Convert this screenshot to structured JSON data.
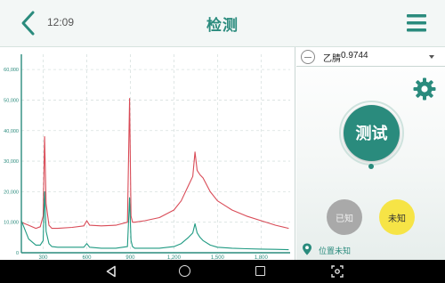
{
  "app": {
    "title": "检测",
    "time": "12:09"
  },
  "colors": {
    "accent": "#2a8b7d",
    "series_red": "#d94b57",
    "series_green": "#1f9a82",
    "unknown_button": "#f6e446",
    "known_button": "#a9a9a9"
  },
  "icons": {
    "back": "chevron-left-icon",
    "menu": "hamburger-menu-icon",
    "settings": "gear-icon",
    "location": "location-pin-icon"
  },
  "selector": {
    "name": "乙腈",
    "value": "0.9744"
  },
  "buttons": {
    "test": "测试",
    "known": "已知",
    "unknown": "未知"
  },
  "location": {
    "text": "位置未知"
  },
  "chart_data": {
    "type": "line",
    "xlim": [
      150,
      2000
    ],
    "ylim": [
      0,
      65000
    ],
    "x_ticks": [
      "300",
      "600",
      "900",
      "1,200",
      "1,500",
      "1,800"
    ],
    "y_ticks": [
      "0",
      "10,000",
      "20,000",
      "30,000",
      "40,000",
      "50,000",
      "60,000"
    ],
    "grid": true,
    "series": [
      {
        "color": "red",
        "x": [
          150,
          200,
          250,
          280,
          300,
          310,
          320,
          340,
          360,
          400,
          500,
          580,
          600,
          620,
          700,
          800,
          880,
          895,
          905,
          915,
          930,
          1000,
          1100,
          1200,
          1250,
          1300,
          1330,
          1345,
          1360,
          1380,
          1400,
          1450,
          1500,
          1600,
          1700,
          1800,
          1900,
          1990
        ],
        "y": [
          10000,
          9000,
          8000,
          8500,
          12000,
          38000,
          16000,
          9000,
          8000,
          8000,
          8300,
          8800,
          10500,
          9000,
          8800,
          9000,
          10000,
          50500,
          12000,
          10000,
          10000,
          10500,
          11500,
          14000,
          17000,
          22000,
          25000,
          33000,
          27000,
          25500,
          24500,
          20000,
          17000,
          14000,
          12000,
          10500,
          9000,
          8000
        ]
      },
      {
        "color": "green",
        "x": [
          150,
          200,
          250,
          280,
          300,
          310,
          320,
          340,
          360,
          400,
          500,
          580,
          600,
          620,
          700,
          800,
          880,
          895,
          905,
          915,
          930,
          1000,
          1100,
          1200,
          1250,
          1300,
          1330,
          1345,
          1360,
          1380,
          1400,
          1450,
          1500,
          1600,
          1700,
          1800,
          1900,
          1990
        ],
        "y": [
          10500,
          4500,
          2500,
          2500,
          4000,
          20000,
          7000,
          3000,
          2000,
          1800,
          1800,
          1800,
          3000,
          1800,
          1500,
          1500,
          2000,
          18000,
          4000,
          2000,
          1500,
          1500,
          1500,
          2000,
          3000,
          5000,
          6500,
          9500,
          6500,
          5000,
          4000,
          2500,
          1800,
          1500,
          1300,
          1200,
          1100,
          1000
        ]
      }
    ]
  }
}
